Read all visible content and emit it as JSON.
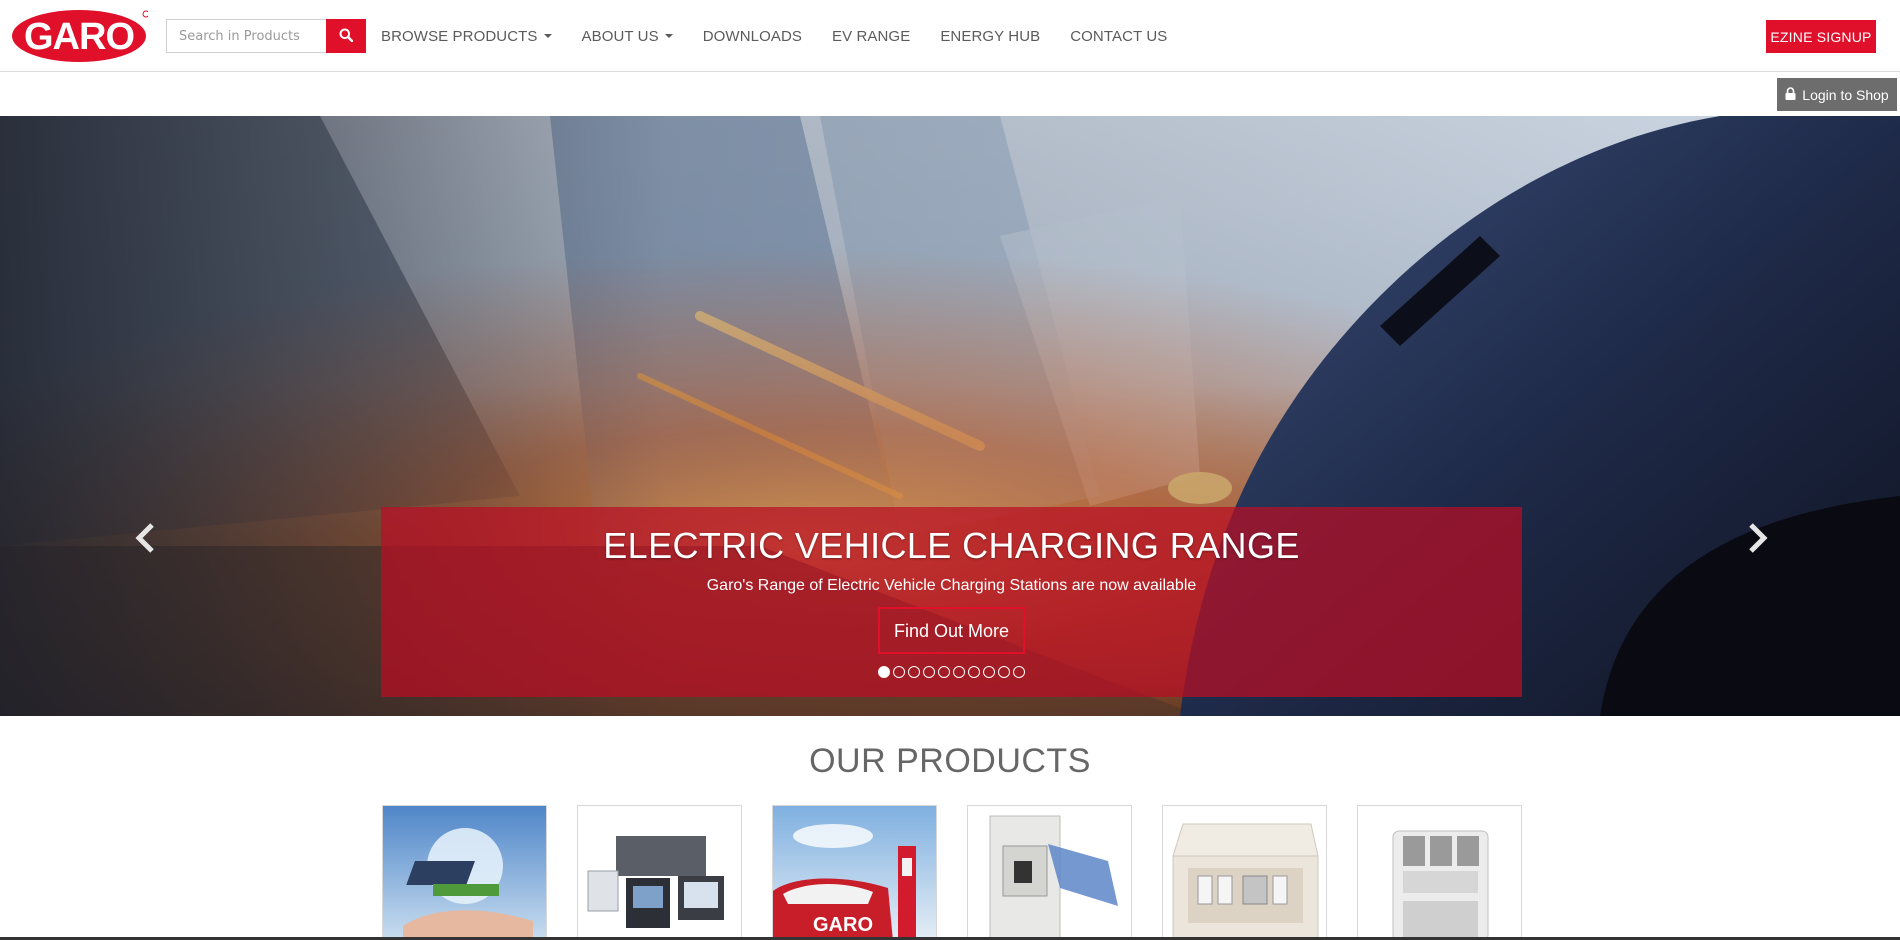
{
  "brand": {
    "logo_text": "GARO",
    "accent_color": "#e0102b"
  },
  "search": {
    "placeholder": "Search in Products",
    "icon": "search-icon"
  },
  "nav": {
    "items": [
      {
        "label": "BROWSE PRODUCTS",
        "has_dropdown": true
      },
      {
        "label": "ABOUT US",
        "has_dropdown": true
      },
      {
        "label": "DOWNLOADS",
        "has_dropdown": false
      },
      {
        "label": "EV RANGE",
        "has_dropdown": false
      },
      {
        "label": "ENERGY HUB",
        "has_dropdown": false
      },
      {
        "label": "CONTACT US",
        "has_dropdown": false
      }
    ]
  },
  "header": {
    "ezine_label": "EZINE SIGNUP",
    "login_label": "Login to Shop",
    "login_icon": "lock-icon"
  },
  "hero": {
    "title": "ELECTRIC VEHICLE CHARGING RANGE",
    "subtitle": "Garo's Range of Electric Vehicle Charging Stations are now available",
    "cta_label": "Find Out More",
    "slide_count": 10,
    "active_slide": 1,
    "prev_icon": "chevron-left-icon",
    "next_icon": "chevron-right-icon"
  },
  "products": {
    "title": "OUR PRODUCTS",
    "items": [
      {
        "image": "solar-lightbulb-hand"
      },
      {
        "image": "energy-meters"
      },
      {
        "image": "ev-charging-car"
      },
      {
        "image": "enclosure-open-lid"
      },
      {
        "image": "consumer-unit"
      },
      {
        "image": "circuit-breaker"
      }
    ]
  }
}
